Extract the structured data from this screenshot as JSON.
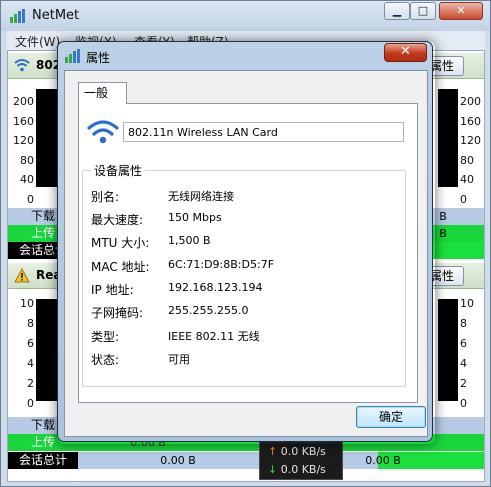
{
  "main_window": {
    "title": "NetMet",
    "menu": [
      "文件(W)",
      "监视(X)",
      "查看(Y)",
      "帮助(Z)"
    ],
    "sections": [
      {
        "name": "802.",
        "properties_label": "属性",
        "axis": [
          "200",
          "160",
          "120",
          "80",
          "40",
          "0"
        ],
        "rows": {
          "download": "下载",
          "upload": "上传",
          "session_total": "会话总计"
        },
        "values": {
          "download": "B",
          "upload": "B",
          "session_total": ""
        }
      },
      {
        "name": "Rea",
        "properties_label": "属性",
        "axis": [
          "10",
          "8",
          "6",
          "4",
          "2",
          "0"
        ],
        "rows": {
          "download": "下载",
          "upload": "上传",
          "session_total": "会话总计"
        },
        "values": {
          "download": "",
          "upload": "0.00 B",
          "session_total": "0.00 B",
          "session_total_right": "0.00 B"
        }
      }
    ],
    "rate": {
      "up_arrow": "↑",
      "up": "0.0 KB/s",
      "down_arrow": "↓",
      "down": "0.0 KB/s"
    }
  },
  "dialog": {
    "title": "属性",
    "close_glyph": "✕",
    "tab": "一般",
    "device_name": "802.11n Wireless LAN Card",
    "group_title": "设备属性",
    "properties": [
      {
        "key": "别名:",
        "value": "无线网络连接"
      },
      {
        "key": "最大速度:",
        "value": "150 Mbps"
      },
      {
        "key": "MTU 大小:",
        "value": "1,500 B"
      },
      {
        "key": "MAC 地址:",
        "value": "6C:71:D9:8B:D5:7F"
      },
      {
        "key": "IP 地址:",
        "value": "192.168.123.194"
      },
      {
        "key": "子网掩码:",
        "value": "255.255.255.0"
      },
      {
        "key": "类型:",
        "value": "IEEE 802.11 无线"
      },
      {
        "key": "状态:",
        "value": "可用"
      }
    ],
    "ok_label": "确定"
  },
  "colors": {
    "upload_row": "#19d63a",
    "download_row": "#b7cbe6",
    "close_button": "#c2391c",
    "wifi_icon": "#2a6fc9"
  }
}
